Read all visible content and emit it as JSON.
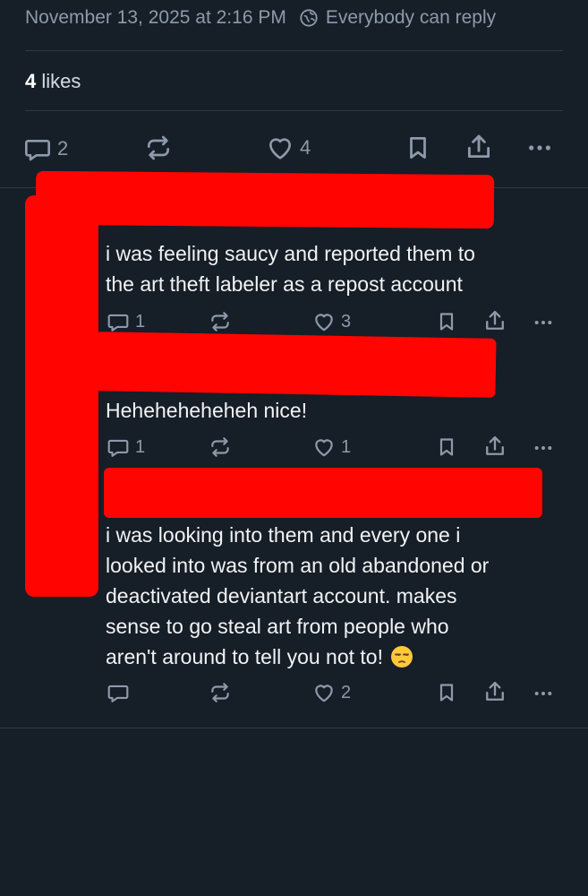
{
  "post": {
    "timestamp": "November 13, 2025 at 2:16 PM",
    "reply_setting": "Everybody can reply",
    "likes_count": "4",
    "likes_label": "likes",
    "actions": {
      "replies": "2",
      "likes": "4"
    }
  },
  "replies": [
    {
      "lines": [
        "i was feeling saucy and reported them to",
        "the art theft labeler as a repost account"
      ],
      "actions": {
        "replies": "1",
        "likes": "3"
      }
    },
    {
      "lines": [
        "Heheheheheheh nice!"
      ],
      "actions": {
        "replies": "1",
        "likes": "1"
      }
    },
    {
      "lines": [
        "i was looking into them and every one i",
        "looked into was from an old abandoned or",
        "deactivated deviantart account. makes",
        "sense to go steal art from people who",
        "aren't around to tell you not to!"
      ],
      "emoji": "unamused-face",
      "actions": {
        "replies": "",
        "likes": "2"
      }
    }
  ],
  "colors": {
    "background": "#161e27",
    "text": "#f1f3f5",
    "muted": "#8d9aab",
    "divider": "#2c3947",
    "redaction": "#ff0400"
  }
}
